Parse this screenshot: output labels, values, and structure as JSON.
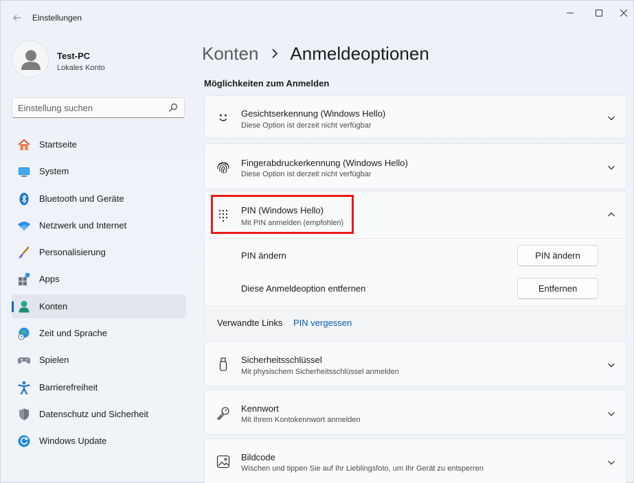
{
  "window": {
    "title": "Einstellungen"
  },
  "profile": {
    "name": "Test-PC",
    "account_type": "Lokales Konto"
  },
  "search": {
    "placeholder": "Einstellung suchen"
  },
  "sidebar": {
    "items": [
      {
        "label": "Startseite",
        "icon": "home-icon"
      },
      {
        "label": "System",
        "icon": "system-icon"
      },
      {
        "label": "Bluetooth und Geräte",
        "icon": "bluetooth-icon"
      },
      {
        "label": "Netzwerk und Internet",
        "icon": "wifi-icon"
      },
      {
        "label": "Personalisierung",
        "icon": "brush-icon"
      },
      {
        "label": "Apps",
        "icon": "apps-icon"
      },
      {
        "label": "Konten",
        "icon": "accounts-icon",
        "selected": true
      },
      {
        "label": "Zeit und Sprache",
        "icon": "clock-globe-icon"
      },
      {
        "label": "Spielen",
        "icon": "gamepad-icon"
      },
      {
        "label": "Barrierefreiheit",
        "icon": "accessibility-icon"
      },
      {
        "label": "Datenschutz und Sicherheit",
        "icon": "shield-icon"
      },
      {
        "label": "Windows Update",
        "icon": "update-icon"
      }
    ]
  },
  "header": {
    "parent": "Konten",
    "current": "Anmeldeoptionen"
  },
  "section": {
    "title": "Möglichkeiten zum Anmelden"
  },
  "options": {
    "face": {
      "title": "Gesichtserkennung (Windows Hello)",
      "subtitle": "Diese Option ist derzeit nicht verfügbar"
    },
    "fingerprint": {
      "title": "Fingerabdruckerkennung (Windows Hello)",
      "subtitle": "Diese Option ist derzeit nicht verfügbar"
    },
    "pin": {
      "title": "PIN (Windows Hello)",
      "subtitle": "Mit PIN anmelden (empfohlen)",
      "change_label": "PIN ändern",
      "change_button": "PIN ändern",
      "remove_label": "Diese Anmeldeoption entfernen",
      "remove_button": "Entfernen",
      "related_label": "Verwandte Links",
      "related_link": "PIN vergessen"
    },
    "security_key": {
      "title": "Sicherheitsschlüssel",
      "subtitle": "Mit physischem Sicherheitsschlüssel anmelden"
    },
    "password": {
      "title": "Kennwort",
      "subtitle": "Mit Ihrem Kontokennwort anmelden"
    },
    "picture": {
      "title": "Bildcode",
      "subtitle": "Wischen und tippen Sie auf Ihr Lieblingsfoto, um Ihr Gerät zu entsperren"
    }
  },
  "colors": {
    "accent": "#0067c0",
    "link": "#005fb8",
    "highlight": "#e81b1b"
  }
}
